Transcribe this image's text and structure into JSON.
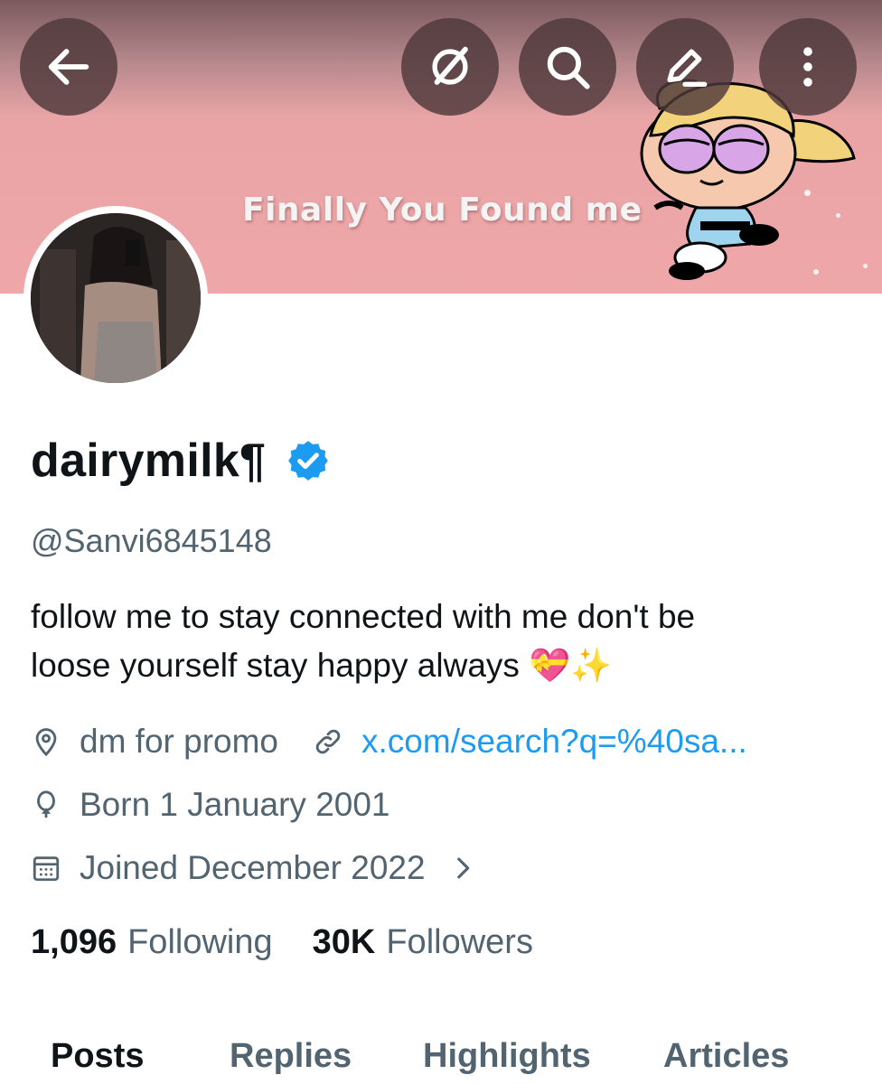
{
  "banner": {
    "text": "Finally You Found me"
  },
  "toolbar": {
    "back_icon": "arrow-left-icon",
    "grok_icon": "grok-icon",
    "search_icon": "search-icon",
    "edit_icon": "pencil-icon",
    "more_icon": "more-vertical-icon"
  },
  "profile": {
    "display_name": "dairymilk¶",
    "verified": true,
    "handle": "@Sanvi6845148",
    "bio_line1": "follow me to stay connected with me don't be",
    "bio_line2": "loose yourself stay happy always",
    "bio_emoji": "💝✨",
    "location": "dm for promo",
    "website": "x.com/search?q=%40sa...",
    "birthday": "Born 1 January 2001",
    "joined": "Joined December 2022",
    "following_count": "1,096",
    "following_label": "Following",
    "followers_count": "30K",
    "followers_label": "Followers"
  },
  "tabs": [
    {
      "label": "Posts",
      "active": true
    },
    {
      "label": "Replies",
      "active": false
    },
    {
      "label": "Highlights",
      "active": false
    },
    {
      "label": "Articles",
      "active": false
    }
  ],
  "colors": {
    "accent": "#1d9bf0",
    "secondary_text": "#536471",
    "banner_pink": "#efa7a9"
  }
}
